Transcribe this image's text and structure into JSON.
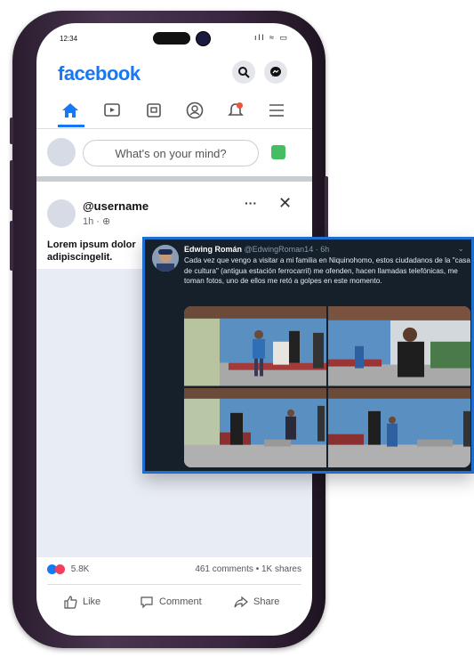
{
  "status_bar": {
    "time": "12:34",
    "icons": "ıll ≈ ▭"
  },
  "header": {
    "logo": "facebook"
  },
  "nav": {
    "items": [
      "home-icon",
      "video-icon",
      "marketplace-icon",
      "profile-icon",
      "notifications-icon",
      "menu-icon"
    ],
    "active": "home-icon"
  },
  "composer": {
    "placeholder": "What's on your mind?"
  },
  "post": {
    "username": "@username",
    "time": "1h · ",
    "text": "Lorem ipsum dolor adipiscingelit.",
    "more": "···",
    "close": "✕"
  },
  "stats": {
    "reactions": "5.8K",
    "comments": "461 comments",
    "shares": "• 1K shares"
  },
  "actions": {
    "like": "Like",
    "comment": "Comment",
    "share": "Share"
  },
  "tweet": {
    "name": "Edwing Román",
    "handle": "@EdwingRoman14 · 6h",
    "text": "Cada vez que vengo a visitar a mi familia en Niquinohomo, estos ciudadanos de la \"casa de cultura\" (antigua estación ferrocarril) me ofenden, hacen llamadas telefónicas, me toman fotos, uno de ellos me retó a golpes en este momento.",
    "chevron": "⌄"
  },
  "colors": {
    "brand": "#1877f2",
    "tweet_bg": "#15202b",
    "tweet_border": "#1d6fd1"
  }
}
